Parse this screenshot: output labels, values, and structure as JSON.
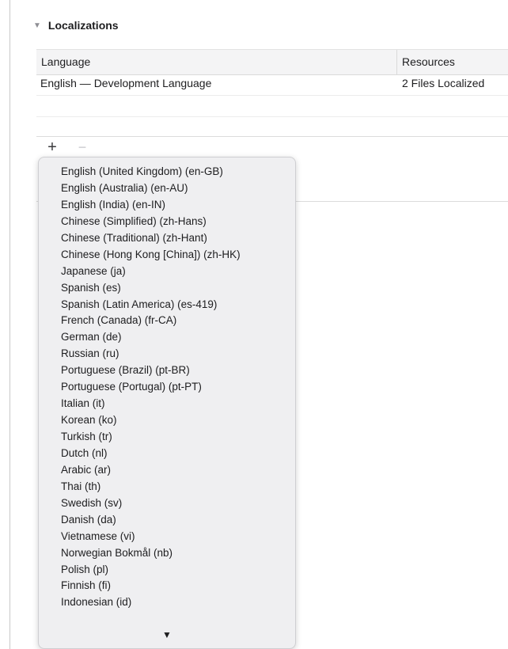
{
  "section": {
    "disclosure_glyph": "▼",
    "title": "Localizations"
  },
  "table": {
    "headers": {
      "language": "Language",
      "resources": "Resources"
    },
    "rows": [
      {
        "language": "English — Development Language",
        "resources": "2 Files Localized"
      }
    ]
  },
  "controls": {
    "add_glyph": "+",
    "remove_glyph": "−"
  },
  "dropdown": {
    "items": [
      "English (United Kingdom) (en-GB)",
      "English (Australia) (en-AU)",
      "English (India) (en-IN)",
      "Chinese (Simplified) (zh-Hans)",
      "Chinese (Traditional) (zh-Hant)",
      "Chinese (Hong Kong [China]) (zh-HK)",
      "Japanese (ja)",
      "Spanish (es)",
      "Spanish (Latin America) (es-419)",
      "French (Canada) (fr-CA)",
      "German (de)",
      "Russian (ru)",
      "Portuguese (Brazil) (pt-BR)",
      "Portuguese (Portugal) (pt-PT)",
      "Italian (it)",
      "Korean (ko)",
      "Turkish (tr)",
      "Dutch (nl)",
      "Arabic (ar)",
      "Thai (th)",
      "Swedish (sv)",
      "Danish (da)",
      "Vietnamese (vi)",
      "Norwegian Bokmål (nb)",
      "Polish (pl)",
      "Finnish (fi)",
      "Indonesian (id)"
    ],
    "scroll_down_glyph": "▼"
  }
}
